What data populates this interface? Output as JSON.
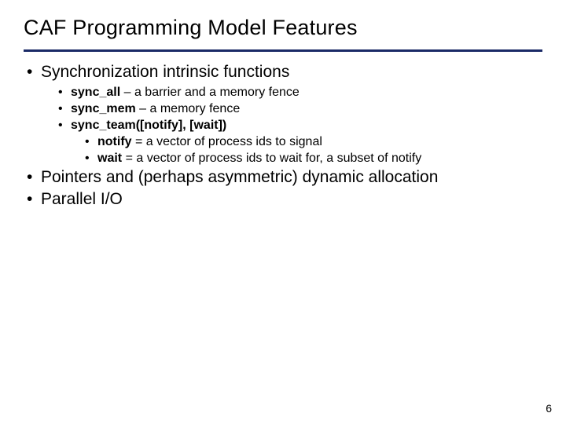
{
  "title": "CAF Programming Model Features",
  "bullets": {
    "b1": "Synchronization intrinsic functions",
    "b1_1_bold": "sync_all",
    "b1_1_rest": " – a barrier and a memory fence",
    "b1_2_bold": "sync_mem",
    "b1_2_rest": " – a memory fence",
    "b1_3_bold": "sync_team([notify], [wait])",
    "b1_3_1_bold": "notify",
    "b1_3_1_rest": " = a vector of process ids to signal",
    "b1_3_2_bold": "wait",
    "b1_3_2_rest": " = a vector of process ids to wait for, a subset of notify",
    "b2": "Pointers and (perhaps asymmetric) dynamic allocation",
    "b3": "Parallel I/O"
  },
  "page_number": "6"
}
